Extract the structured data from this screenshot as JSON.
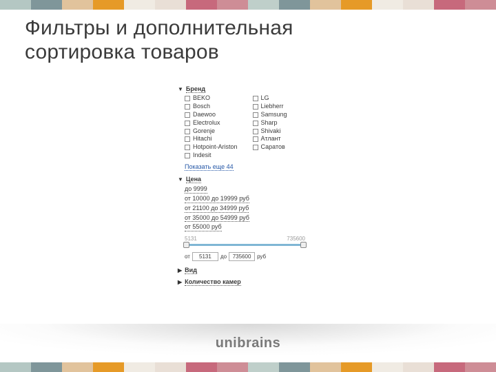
{
  "stripes": [
    "#b4c7c3",
    "#7f969a",
    "#e1c39c",
    "#e69a27",
    "#f0ebe3",
    "#e9dfd6",
    "#c7697c",
    "#ce8d96",
    "#bfcfca",
    "#7f969a",
    "#e1c39c",
    "#e69a27",
    "#f0ebe3",
    "#e9dfd6",
    "#c7697c",
    "#ce8d96"
  ],
  "title_line1": "Фильтры и дополнительная",
  "title_line2": "сортировка товаров",
  "filters": {
    "brand": {
      "header": "Бренд",
      "col1": [
        "BEKO",
        "Bosch",
        "Daewoo",
        "Electrolux",
        "Gorenje",
        "Hitachi",
        "Hotpoint-Ariston",
        "Indesit"
      ],
      "col2": [
        "LG",
        "Liebherr",
        "Samsung",
        "Sharp",
        "Shivaki",
        "Атлант",
        "Саратов"
      ],
      "show_more": "Показать еще 44"
    },
    "price": {
      "header": "Цена",
      "ranges": [
        "до 9999",
        "от 10000 до 19999 руб",
        "от 21100 до 34999 руб",
        "от 35000 до 54999 руб",
        "от 55000 руб"
      ],
      "min_label": "5131",
      "max_label": "735600",
      "from": "от",
      "to": "до",
      "from_val": "5131",
      "to_val": "735600",
      "unit": "руб"
    },
    "type": {
      "header": "Вид"
    },
    "cameras": {
      "header": "Количество камер"
    }
  },
  "footer": {
    "brand": "unibrains"
  }
}
